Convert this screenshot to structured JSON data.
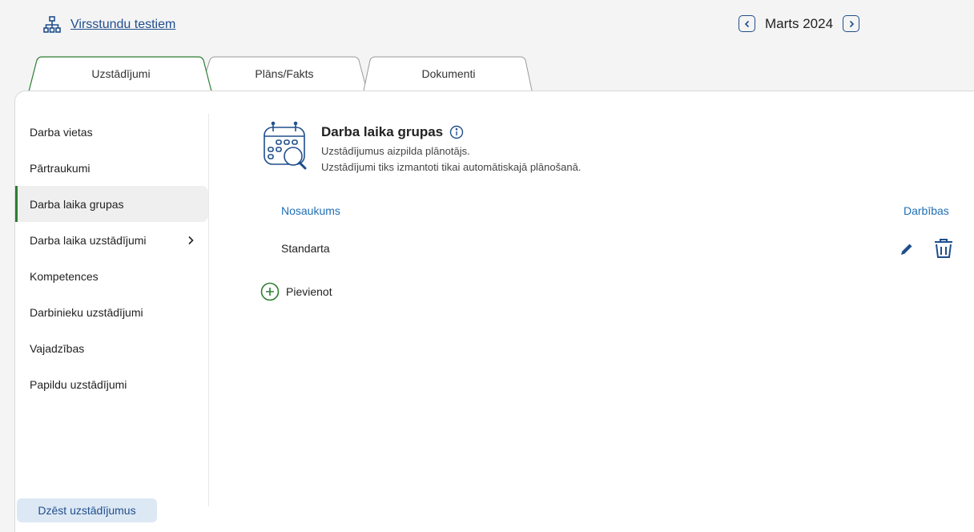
{
  "header": {
    "link_label": "Virsstundu testiem",
    "month_label": "Marts 2024"
  },
  "tabs": [
    {
      "label": "Uzstādījumi",
      "active": true
    },
    {
      "label": "Plāns/Fakts",
      "active": false
    },
    {
      "label": "Dokumenti",
      "active": false
    }
  ],
  "sidebar": {
    "items": [
      {
        "label": "Darba vietas"
      },
      {
        "label": "Pārtraukumi"
      },
      {
        "label": "Darba laika grupas",
        "active": true
      },
      {
        "label": "Darba laika uzstādījumi",
        "has_submenu": true
      },
      {
        "label": "Kompetences"
      },
      {
        "label": "Darbinieku uzstādījumi"
      },
      {
        "label": "Vajadzības"
      },
      {
        "label": "Papildu uzstādījumi"
      }
    ],
    "delete_label": "Dzēst uzstādījumus"
  },
  "main": {
    "title": "Darba laika grupas",
    "subtitle_1": "Uzstādījumus aizpilda plānotājs.",
    "subtitle_2": "Uzstādījumi tiks izmantoti tikai automātiskajā plānošanā.",
    "table": {
      "headers": {
        "name": "Nosaukums",
        "actions": "Darbības"
      },
      "rows": [
        {
          "name": "Standarta"
        }
      ]
    },
    "add_label": "Pievienot"
  },
  "colors": {
    "accent_green": "#2e7d32",
    "link_blue": "#1f4e8c",
    "header_blue": "#1f6fb5"
  },
  "icons": {
    "org": "org-chart-icon",
    "prev": "chevron-left-icon",
    "next": "chevron-right-icon",
    "group": "calendar-search-icon",
    "info": "info-icon",
    "edit": "pencil-icon",
    "delete": "trash-icon",
    "add": "plus-circle-icon"
  }
}
